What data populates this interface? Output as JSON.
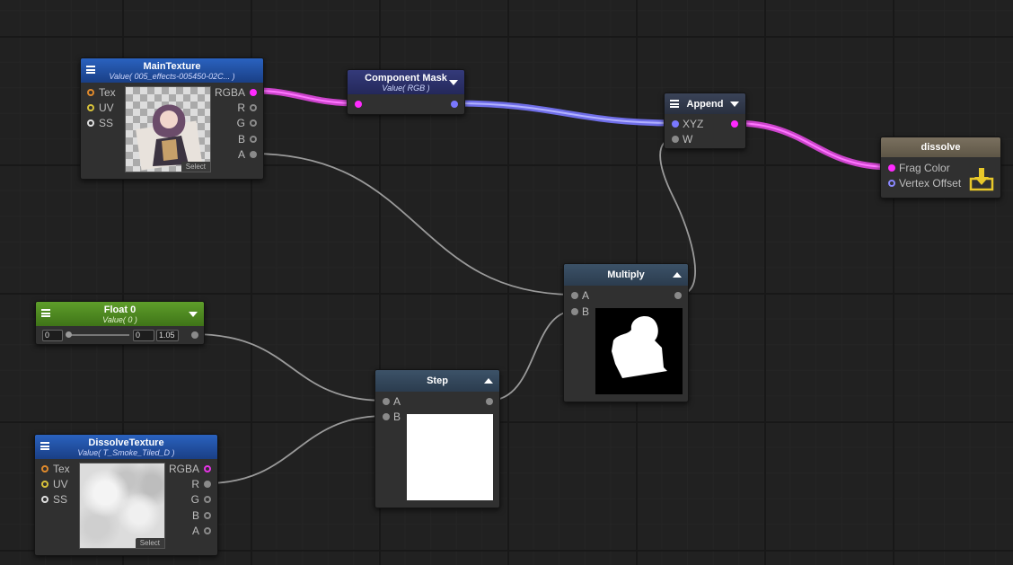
{
  "nodes": {
    "main_texture": {
      "title": "MainTexture",
      "subtitle": "Value( 005_effects-005450-02C... )",
      "inputs": [
        "Tex",
        "UV",
        "SS"
      ],
      "outputs": [
        "RGBA",
        "R",
        "G",
        "B",
        "A"
      ],
      "select_label": "Select"
    },
    "component_mask": {
      "title": "Component Mask",
      "subtitle": "Value( RGB )"
    },
    "append": {
      "title": "Append",
      "inputs": [
        "XYZ",
        "W"
      ]
    },
    "dissolve": {
      "title": "dissolve",
      "inputs": [
        "Frag Color",
        "Vertex Offset"
      ]
    },
    "multiply": {
      "title": "Multiply",
      "inputs": [
        "A",
        "B"
      ]
    },
    "float0": {
      "title": "Float 0",
      "subtitle": "Value( 0 )",
      "min": "0",
      "value": "0",
      "max": "1.05"
    },
    "step": {
      "title": "Step",
      "inputs": [
        "A",
        "B"
      ]
    },
    "dissolve_texture": {
      "title": "DissolveTexture",
      "subtitle": "Value( T_Smoke_Tiled_D )",
      "inputs": [
        "Tex",
        "UV",
        "SS"
      ],
      "outputs": [
        "RGBA",
        "R",
        "G",
        "B",
        "A"
      ],
      "select_label": "Select"
    }
  },
  "colors": {
    "header_texture": "#1f4fa0",
    "header_mask": "#2b2e66",
    "header_append": "#2d3448",
    "header_output": "#6e6454",
    "header_math": "#33465a",
    "header_float": "#4e8a22",
    "wire_color": "#ee55ee",
    "wire_vector": "#8b8cff",
    "wire_scalar": "#9a9a9a"
  }
}
